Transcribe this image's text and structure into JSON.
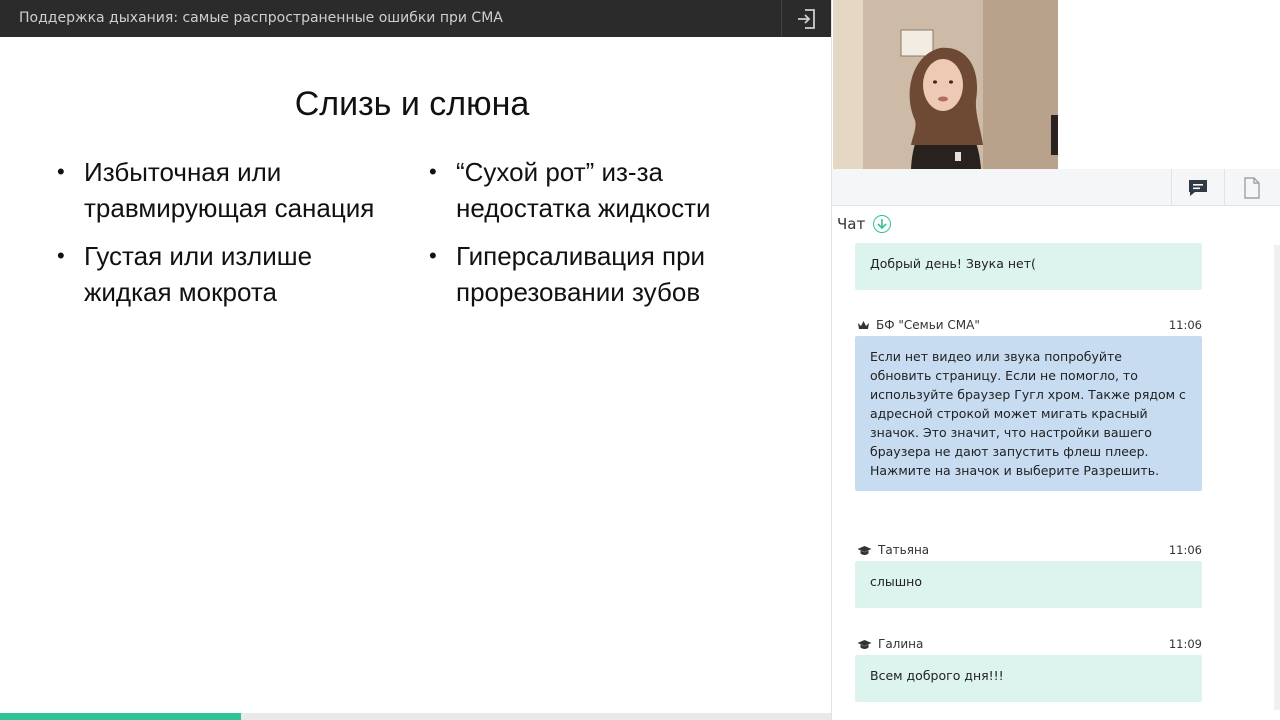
{
  "topbar": {
    "title": "Поддержка дыхания: самые распространенные ошибки при СМА"
  },
  "slide": {
    "title": "Слизь и слюна",
    "left_bullets": [
      "Избыточная или травмирующая санация",
      "Густая или излише жидкая мокрота"
    ],
    "right_bullets": [
      "“Сухой рот” из-за недостатка жидкости",
      "Гиперсаливация при прорезовании зубов"
    ]
  },
  "progress": {
    "fraction": 0.29
  },
  "chat": {
    "label": "Чат",
    "messages": [
      {
        "author": "",
        "time": "",
        "text": "Добрый день! Звука нет(",
        "role": "user"
      },
      {
        "author": "БФ \"Семьи СМА\"",
        "time": "11:06",
        "text": "Если нет видео или звука попробуйте обновить страницу. Если не помогло, то используйте браузер Гугл хром. Также рядом с адресной строкой может мигать красный значок. Это значит, что настройки вашего браузера не дают запустить флеш плеер. Нажмите на значок и выберите Разрешить.",
        "role": "moderator"
      },
      {
        "author": "Татьяна",
        "time": "11:06",
        "text": "слышно",
        "role": "user"
      },
      {
        "author": "Галина",
        "time": "11:09",
        "text": "Всем доброго дня!!!",
        "role": "user"
      }
    ]
  },
  "colors": {
    "accent": "#2fc39a",
    "topbar": "#2b2b2b",
    "user_bubble": "#ddf4ee",
    "moderator_bubble": "#c7dcf1"
  }
}
